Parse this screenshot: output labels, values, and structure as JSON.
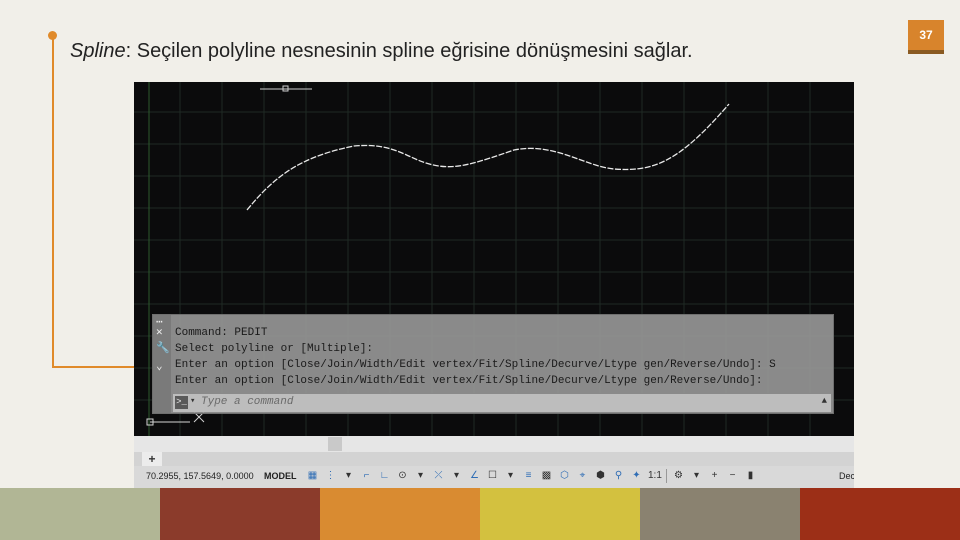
{
  "slide": {
    "title_term": "Spline",
    "title_rest": ": Seçilen polyline nesnesinin spline eğrisine dönüşmesini sağlar.",
    "page_number": "37"
  },
  "command_window": {
    "lines": [
      "Command: PEDIT",
      "Select polyline or [Multiple]:",
      "Enter an option [Close/Join/Width/Edit vertex/Fit/Spline/Decurve/Ltype gen/Reverse/Undo]: S",
      "Enter an option [Close/Join/Width/Edit vertex/Fit/Spline/Decurve/Ltype gen/Reverse/Undo]:"
    ],
    "placeholder": "Type a command",
    "side_icons": [
      "close-icon",
      "wrench-icon",
      "chevron-down-icon"
    ]
  },
  "status_bar": {
    "coordinates": "70.2955, 157.5649, 0.0000",
    "mode": "MODEL",
    "annotation_scale": "1:1",
    "trailing": "Dec",
    "icons": [
      "grid-icon",
      "snap-icon",
      "infer-icon",
      "ortho-icon",
      "polar-icon",
      "osnap-icon",
      "otrack-icon",
      "lineweight-icon",
      "transparency-icon",
      "selection-cycling-icon",
      "3d-osnap-icon",
      "dynamic-ucs-icon",
      "gizmo-icon",
      "annotation-visibility-icon",
      "auto-scale-icon",
      "workspace-icon",
      "annotation-monitor-icon",
      "units-icon",
      "quick-properties-icon",
      "customize-icon"
    ]
  },
  "colors": {
    "accent": "#e08a2a",
    "background": "#f1efe9",
    "bottom_bar": [
      "#b1b695",
      "#8b3b2b",
      "#d98b31",
      "#d3c13f",
      "#8a8270",
      "#9c2f17"
    ]
  }
}
